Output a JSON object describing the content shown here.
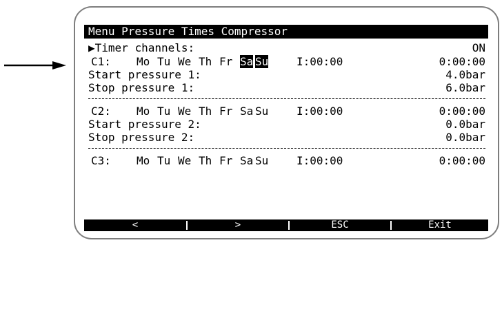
{
  "title": "Menu Pressure Times Compressor",
  "timer": {
    "cursor": "▶",
    "label": "Timer channels:",
    "value": "ON"
  },
  "channels": [
    {
      "id": "C1:",
      "days": [
        "Mo",
        "Tu",
        "We",
        "Th",
        "Fr",
        "Sa",
        "Su"
      ],
      "selected_days": [
        "Sa",
        "Su"
      ],
      "time_in": "I:00:00",
      "time_out": "0:00:00",
      "start_label": "Start pressure 1:",
      "start_value": "4.0bar",
      "stop_label": "Stop pressure 1:",
      "stop_value": "6.0bar"
    },
    {
      "id": "C2:",
      "days": [
        "Mo",
        "Tu",
        "We",
        "Th",
        "Fr",
        "Sa",
        "Su"
      ],
      "selected_days": [],
      "time_in": "I:00:00",
      "time_out": "0:00:00",
      "start_label": "Start pressure 2:",
      "start_value": "0.0bar",
      "stop_label": "Stop pressure 2:",
      "stop_value": "0.0bar"
    },
    {
      "id": "C3:",
      "days": [
        "Mo",
        "Tu",
        "We",
        "Th",
        "Fr",
        "Sa",
        "Su"
      ],
      "selected_days": [],
      "time_in": "I:00:00",
      "time_out": "0:00:00"
    }
  ],
  "softkeys": [
    "<",
    ">",
    "ESC",
    "Exit"
  ],
  "icons": {
    "pointer": "arrow-right-icon"
  }
}
